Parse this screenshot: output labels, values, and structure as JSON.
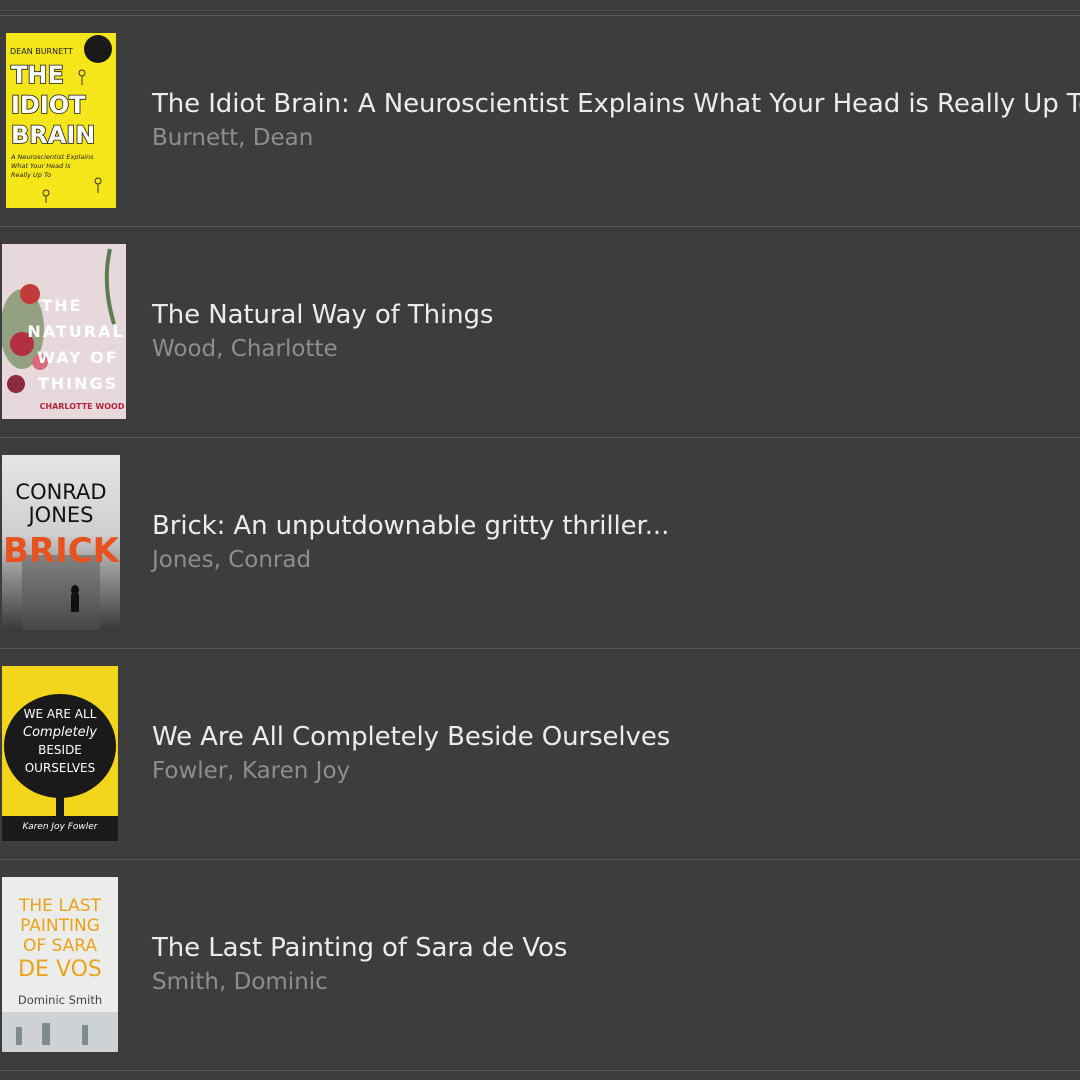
{
  "books": [
    {
      "title": "The Idiot Brain: A Neuroscientist Explains What Your Head is Really Up To",
      "author": "Burnett, Dean",
      "cover": {
        "top_text": "DEAN BURNETT",
        "lines": [
          "THE",
          "IDIOT",
          "BRAIN"
        ],
        "sub": [
          "A Neuroscientist Explains",
          "What Your Head Is",
          "Really Up To"
        ],
        "bg": "#f5e61a"
      }
    },
    {
      "title": "The Natural Way of Things",
      "author": "Wood, Charlotte",
      "cover": {
        "lines": [
          "THE",
          "NATURAL",
          "WAY OF",
          "THINGS"
        ],
        "byline": "CHARLOTTE WOOD",
        "bg": "#e7d8dc"
      }
    },
    {
      "title": "Brick: An unputdownable gritty thriller...",
      "author": "Jones, Conrad",
      "cover": {
        "lines": [
          "CONRAD",
          "JONES"
        ],
        "big": "BRICK",
        "bg": "#d6d6d6",
        "accent": "#e8521e"
      }
    },
    {
      "title": "We Are All Completely Beside Ourselves",
      "author": "Fowler, Karen Joy",
      "cover": {
        "lines": [
          "WE ARE ALL",
          "Completely",
          "BESIDE",
          "OURSELVES"
        ],
        "byline": "Karen Joy Fowler",
        "bg": "#f3d61c"
      }
    },
    {
      "title": "The Last Painting of Sara de Vos",
      "author": "Smith, Dominic",
      "cover": {
        "lines": [
          "THE LAST",
          "PAINTING",
          "OF SARA",
          "DE VOS"
        ],
        "byline": "Dominic Smith",
        "bg": "#ececea",
        "accent": "#e9a21c"
      }
    }
  ]
}
